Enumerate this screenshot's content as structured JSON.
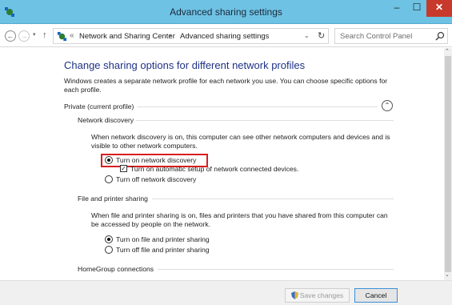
{
  "window": {
    "title": "Advanced sharing settings",
    "minimize": "–",
    "maximize": "☐",
    "close": "✕"
  },
  "nav": {
    "back": "←",
    "forward": "→",
    "history": "▾",
    "up": "↑"
  },
  "address": {
    "overflow": "«",
    "crumbs": [
      "Network and Sharing Center",
      "Advanced sharing settings"
    ],
    "arrow": "▸",
    "dropdown": "⌄",
    "refresh": "↻"
  },
  "search": {
    "placeholder": "Search Control Panel"
  },
  "main": {
    "heading": "Change sharing options for different network profiles",
    "intro": "Windows creates a separate network profile for each network you use. You can choose specific options for each profile.",
    "profile": {
      "label": "Private (current profile)",
      "collapse": "⌃"
    },
    "network_discovery": {
      "title": "Network discovery",
      "description": "When network discovery is on, this computer can see other network computers and devices and is visible to other network computers.",
      "options": [
        {
          "label": "Turn on network discovery",
          "selected": true
        },
        {
          "label": "Turn off network discovery",
          "selected": false
        }
      ],
      "auto_setup": {
        "label": "Turn on automatic setup of network connected devices.",
        "checked": true
      }
    },
    "file_printer": {
      "title": "File and printer sharing",
      "description": "When file and printer sharing is on, files and printers that you have shared from this computer can be accessed by people on the network.",
      "options": [
        {
          "label": "Turn on file and printer sharing",
          "selected": true
        },
        {
          "label": "Turn off file and printer sharing",
          "selected": false
        }
      ]
    },
    "homegroup": {
      "title": "HomeGroup connections"
    }
  },
  "footer": {
    "save": "Save changes",
    "cancel": "Cancel"
  },
  "colors": {
    "titlebar": "#6ec2e4",
    "heading": "#1e3287",
    "highlight": "#d81e1e",
    "close": "#c7392a"
  }
}
